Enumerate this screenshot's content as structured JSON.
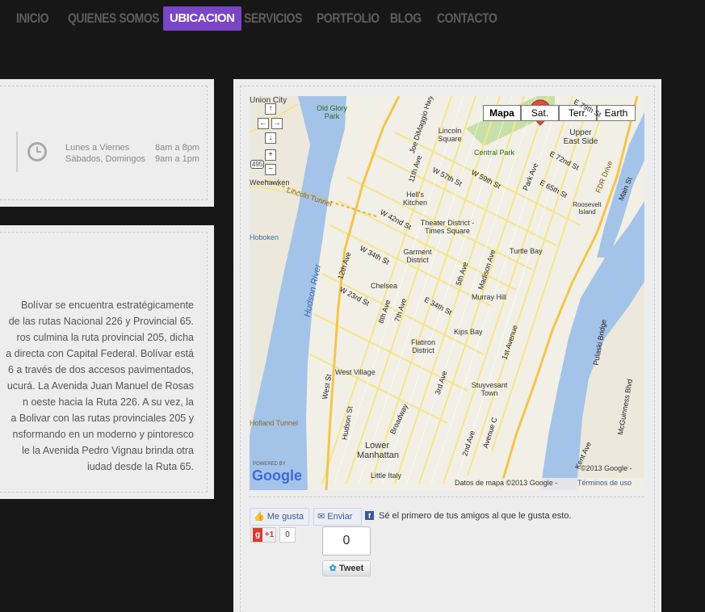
{
  "nav": {
    "items": [
      "INICIO",
      "QUIENES SOMOS",
      "UBICACION",
      "SERVICIOS",
      "PORTFOLIO",
      "BLOG",
      "CONTACTO"
    ],
    "active_index": 2
  },
  "hours": {
    "rows": [
      {
        "days": "Lunes a Viernes",
        "time": "8am a 8pm"
      },
      {
        "days": "Sábados, Domingos",
        "time": "9am a 1pm"
      }
    ]
  },
  "description": {
    "lines": [
      "Bolívar se encuentra estratégicamente",
      "de las rutas Nacional 226 y Provincial 65.",
      "ros culmina la ruta provincial 205, dicha",
      "a directa con Capital Federal. Bolívar está",
      "6 a través de dos accesos pavimentados,",
      "ucurá. La Avenida Juan Manuel de Rosas",
      "n oeste hacia la Ruta 226. A su vez, la",
      "a Bolivar con las rutas provinciales 205 y",
      "nsformando en un moderno y pintoresco",
      "le la Avenida Pedro Vignau brinda otra",
      "iudad desde la Ruta 65."
    ]
  },
  "map": {
    "types": [
      "Mapa",
      "Sat.",
      "Terr.",
      "Earth"
    ],
    "selected_type": "Mapa",
    "pan_up": "↑",
    "pan_left": "←",
    "pan_right": "→",
    "pan_down": "↓",
    "zoom_in": "+",
    "zoom_out": "−",
    "highway_badge": "495",
    "places": [
      {
        "name": "Lincoln Tunnel"
      },
      {
        "name": "Old Glory Park"
      },
      {
        "name": "Union City"
      },
      {
        "name": "Lincoln Square"
      },
      {
        "name": "Central Park"
      },
      {
        "name": "Upper East Side"
      },
      {
        "name": "Hell's Kitchen"
      },
      {
        "name": "Theater District - Times Square"
      },
      {
        "name": "Garment District"
      },
      {
        "name": "Turtle Bay"
      },
      {
        "name": "Chelsea"
      },
      {
        "name": "Murray Hill"
      },
      {
        "name": "Kips Bay"
      },
      {
        "name": "Flatiron District"
      },
      {
        "name": "West Village"
      },
      {
        "name": "Stuyvesant Town"
      },
      {
        "name": "Lower Manhattan"
      },
      {
        "name": "Little Italy"
      },
      {
        "name": "Roosevelt Island"
      },
      {
        "name": "Hudson River"
      },
      {
        "name": "Hoboken"
      },
      {
        "name": "Weehawken"
      }
    ],
    "streets": [
      "Joe DiMaggio Hwy",
      "11th Ave",
      "W 57th St",
      "W 59th St",
      "E 79th St",
      "E 72nd St",
      "E 65th St",
      "Park Ave",
      "FDR Drive",
      "Main St",
      "W 42nd St",
      "W 34th St",
      "12th Ave",
      "W 23rd St",
      "8th Ave",
      "7th Ave",
      "5th Ave",
      "Madison Ave",
      "E 34th St",
      "1st Avenue",
      "West St",
      "Hudson St",
      "Broadway",
      "2nd Ave",
      "3rd Ave",
      "Avenue C",
      "Pulaski Bridge",
      "McGuinness Blvd",
      "Kent Ave",
      "Holland Tunnel"
    ],
    "copyright": "©2013 Google -",
    "footer": "Datos de mapa ©2013 Google -",
    "terms": "Términos de uso",
    "powered_by": "POWERED BY",
    "google": "Google"
  },
  "social": {
    "like": "Me gusta",
    "send": "Enviar",
    "fb_text": "Sé el primero de tus amigos al que le gusta esto.",
    "gplus": "+1",
    "gplus_count": "0",
    "tweet_count": "0",
    "tweet": "Tweet"
  },
  "colors": {
    "accent": "#7a45c6",
    "background": "#171717",
    "panel": "#ededed",
    "water": "#a4c3e8",
    "road": "#f7e98e"
  }
}
